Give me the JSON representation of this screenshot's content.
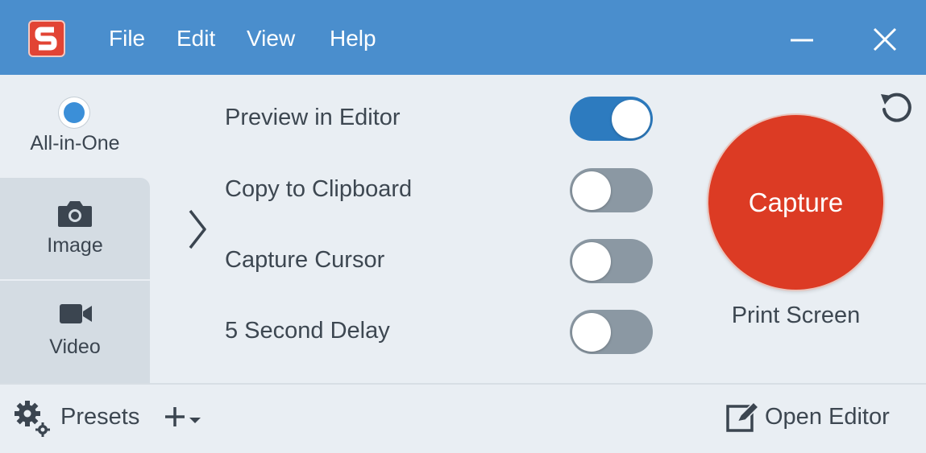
{
  "colors": {
    "titlebar": "#4a8ecd",
    "capture": "#dc3b24",
    "toggle_on": "#2d7bbf",
    "toggle_off": "#8b98a3",
    "logo": "#e24434"
  },
  "titlebar": {
    "logo_icon": "snagit-logo-icon",
    "menu": [
      "File",
      "Edit",
      "View",
      "Help"
    ],
    "minimize_icon": "minimize-icon",
    "close_icon": "close-icon"
  },
  "modes": [
    {
      "label": "All-in-One",
      "icon": "radio-icon",
      "selected": true
    },
    {
      "label": "Image",
      "icon": "camera-icon",
      "selected": false
    },
    {
      "label": "Video",
      "icon": "video-camera-icon",
      "selected": false
    }
  ],
  "options": [
    {
      "label": "Preview in Editor",
      "on": true
    },
    {
      "label": "Copy to Clipboard",
      "on": false
    },
    {
      "label": "Capture Cursor",
      "on": false
    },
    {
      "label": "5 Second Delay",
      "on": false
    }
  ],
  "capture": {
    "label": "Capture",
    "hotkey": "Print Screen",
    "reset_icon": "reset-icon",
    "expand_icon": "chevron-right-icon"
  },
  "bottombar": {
    "presets_label": "Presets",
    "presets_icon": "gear-icon",
    "add_icon": "plus-dropdown-icon",
    "open_editor_label": "Open Editor",
    "open_editor_icon": "edit-icon"
  }
}
